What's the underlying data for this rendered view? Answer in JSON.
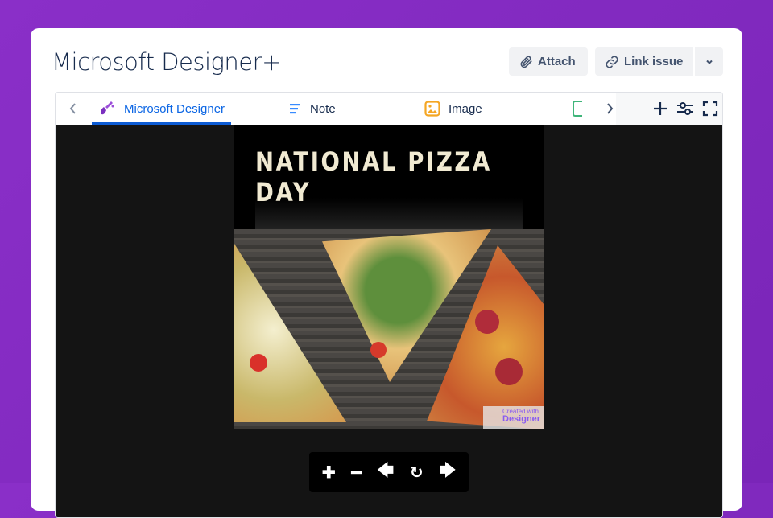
{
  "header": {
    "title": "Microsoft Designer+",
    "attach": "Attach",
    "link_issue": "Link issue"
  },
  "tabs": [
    {
      "label": "Microsoft Designer",
      "icon": "designer-icon",
      "active": true
    },
    {
      "label": "Note",
      "icon": "note-icon"
    },
    {
      "label": "Image",
      "icon": "image-icon"
    }
  ],
  "image": {
    "headline": "NATIONAL PIZZA DAY",
    "watermark_small": "Created with",
    "watermark_big": "Designer"
  },
  "colors": {
    "accent": "#0c66e4",
    "background": "#8a2fc8"
  }
}
